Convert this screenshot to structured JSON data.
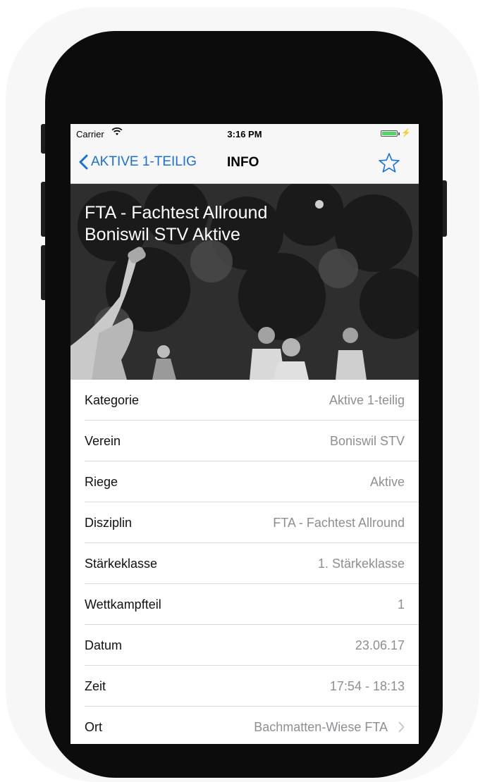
{
  "status_bar": {
    "carrier": "Carrier",
    "time": "3:16 PM",
    "battery_level": 1.0
  },
  "nav_bar": {
    "back_label": "AKTIVE 1-TEILIG",
    "title": "INFO",
    "favorite_icon": "star-outline-icon"
  },
  "header": {
    "title_line1": "FTA - Fachtest Allround",
    "title_line2": "Boniswil STV Aktive"
  },
  "details": [
    {
      "label": "Kategorie",
      "value": "Aktive 1-teilig"
    },
    {
      "label": "Verein",
      "value": "Boniswil STV"
    },
    {
      "label": "Riege",
      "value": "Aktive"
    },
    {
      "label": "Disziplin",
      "value": "FTA - Fachtest Allround"
    },
    {
      "label": "Stärkeklasse",
      "value": "1. Stärkeklasse"
    },
    {
      "label": "Wettkampfteil",
      "value": "1"
    },
    {
      "label": "Datum",
      "value": "23.06.17"
    },
    {
      "label": "Zeit",
      "value": "17:54 - 18:13"
    },
    {
      "label": "Ort",
      "value": "Bachmatten-Wiese FTA"
    }
  ],
  "colors": {
    "accent": "#1a6fe0",
    "battery": "#4cd964",
    "secondary_text": "#8e8e93"
  }
}
